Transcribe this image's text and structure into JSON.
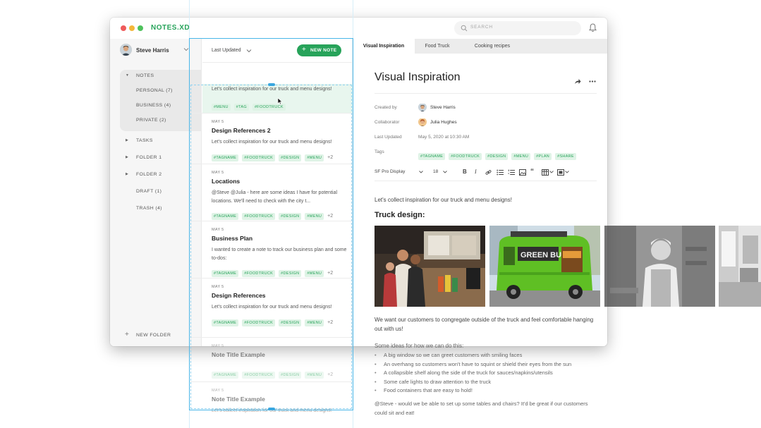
{
  "app": {
    "title": "NOTES.XD",
    "search_placeholder": "SEARCH"
  },
  "window_dots": {
    "colors": [
      "#ef5b5b",
      "#f4b73a",
      "#4fc25c"
    ]
  },
  "colors": {
    "accent": "#27a35a",
    "tag_bg": "#dff3e6",
    "selection": "#49b6e8"
  },
  "user": {
    "name": "Steve Harris"
  },
  "sidebar": {
    "notes_label": "NOTES",
    "notes_children": [
      "PERSONAL (7)",
      "BUSINESS (4)",
      "PRIVATE (2)"
    ],
    "items": [
      {
        "label": "TASKS",
        "caret": true
      },
      {
        "label": "FOLDER 1",
        "caret": true
      },
      {
        "label": "FOLDER 2",
        "caret": true
      },
      {
        "label": "DRAFT (1)",
        "caret": false
      },
      {
        "label": "TRASH (4)",
        "caret": false
      }
    ],
    "new_folder": "NEW FOLDER"
  },
  "list": {
    "sort_label": "Last Updated",
    "new_note_label": "NEW NOTE",
    "first_note": {
      "body": "Let's collect inspiration for our truck and menu designs!",
      "tags": [
        "#MENU",
        "#TAG",
        "#FOODTRUCK"
      ]
    },
    "notes": [
      {
        "date": "MAY 5",
        "title": "Design References 2",
        "body": "Let's collect inspiration for our truck and menu designs!",
        "tags": [
          "#TAGNAME",
          "#FOODTRUCK",
          "#DESIGN",
          "#MENU"
        ],
        "more": "+2"
      },
      {
        "date": "MAY 5",
        "title": "Locations",
        "body": "@Steve @Julia - here are some ideas I have for potential locations. We'll need to check with the city t...",
        "tags": [
          "#TAGNAME",
          "#FOODTRUCK",
          "#DESIGN",
          "#MENU"
        ],
        "more": "+2"
      },
      {
        "date": "MAY 5",
        "title": "Business Plan",
        "body": "I wanted to create a note to track our business plan and some to-dos:",
        "tags": [
          "#TAGNAME",
          "#FOODTRUCK",
          "#DESIGN",
          "#MENU"
        ],
        "more": "+2"
      },
      {
        "date": "MAY 5",
        "title": "Design References",
        "body": "Let's collect inspiration for our truck and menu designs!",
        "tags": [
          "#TAGNAME",
          "#FOODTRUCK",
          "#DESIGN",
          "#MENU"
        ],
        "more": "+2"
      },
      {
        "date": "MAY 5",
        "title": "Note Title Example",
        "body": "",
        "tags": [
          "#TAGNAME",
          "#FOODTRUCK",
          "#DESIGN",
          "#MENU"
        ],
        "more": "+2"
      },
      {
        "date": "MAY 5",
        "title": "Note Title Example",
        "body": "Let's collect inspiration for our truck and menu designs!",
        "tags": [],
        "more": ""
      }
    ]
  },
  "tabs": [
    "Visual Inspiration",
    "Food Truck",
    "Cooking recipes"
  ],
  "doc": {
    "title": "Visual Inspiration",
    "created_by_label": "Created by",
    "created_by": "Steve Harris",
    "collaborator_label": "Collaborator",
    "collaborator": "Julia Hughes",
    "last_updated_label": "Last Updated",
    "last_updated": "May 5, 2020 at 10:30 AM",
    "tags_label": "Tags",
    "tags": [
      "#TAGNAME",
      "#FOODTRUCK",
      "#DESIGN",
      "#MENU",
      "#PLAN",
      "#SHARE"
    ],
    "font_name": "SF Pro Display",
    "font_size": "18",
    "intro": "Let's collect inspiration for our truck and menu designs!",
    "section_heading": "Truck design:",
    "truck_label": "GREEN BUS",
    "para1": "We want our customers to congregate outside of the truck and feel comfortable hanging out with us!",
    "ideas_intro": "Some ideas for how we can do this:",
    "bullets": [
      "A big window so we can greet customers with smiling faces",
      "An overhang so customers won't have to squint or shield their eyes from the sun",
      "A collapsible shelf along the side of the truck for sauces/napkins/utensils",
      "Some cafe lights to draw attention to the truck",
      "Food containers that are easy to hold!"
    ],
    "closing": "@Steve - would we be able to set up some tables and chairs? It'd be great if our customers could sit and eat!"
  }
}
